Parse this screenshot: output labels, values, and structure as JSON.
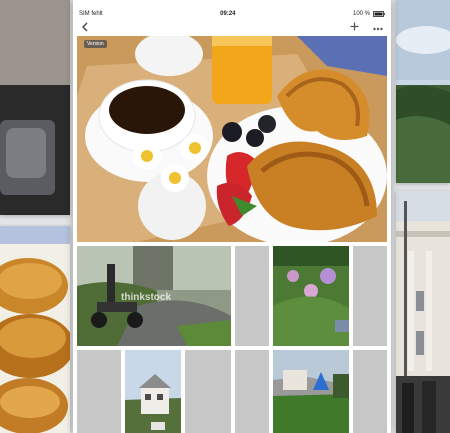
{
  "status_bar": {
    "carrier": "SIM fehlt",
    "time": "09:24",
    "battery": "100 %"
  },
  "nav": {
    "back_icon": "chevron-left",
    "add_icon": "plus",
    "more_icon": "ellipsis"
  },
  "hero": {
    "badge_label": "Version"
  },
  "grid": {
    "watermark": "thinkstock"
  }
}
